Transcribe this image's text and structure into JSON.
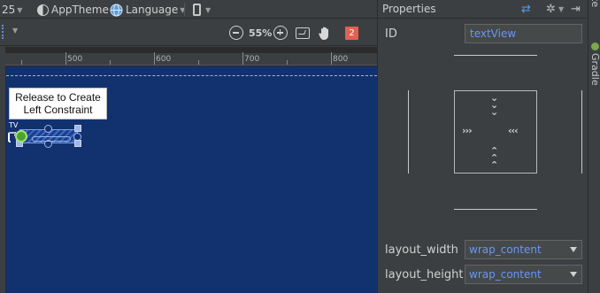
{
  "toolbar": {
    "api_level": "25",
    "theme": "AppTheme",
    "language": "Language",
    "zoom_level": "55%",
    "issue_count": "2"
  },
  "ruler": {
    "ticks": [
      "500",
      "600",
      "700",
      "800"
    ]
  },
  "canvas": {
    "tooltip_line1": "Release to Create",
    "tooltip_line2": "Left Constraint",
    "widget_label": "TV"
  },
  "properties": {
    "title": "Properties",
    "id_label": "ID",
    "id_value": "textView",
    "layout_width_label": "layout_width",
    "layout_width_value": "wrap_content",
    "layout_height_label": "layout_height",
    "layout_height_value": "wrap_content"
  },
  "side_tabs": {
    "palette": "Palette",
    "gradle": "Gradle"
  },
  "colors": {
    "blueprint": "#12316f",
    "link_text": "#6897f5",
    "badge": "#e45f4f",
    "anchor_green": "#4ca42f"
  }
}
